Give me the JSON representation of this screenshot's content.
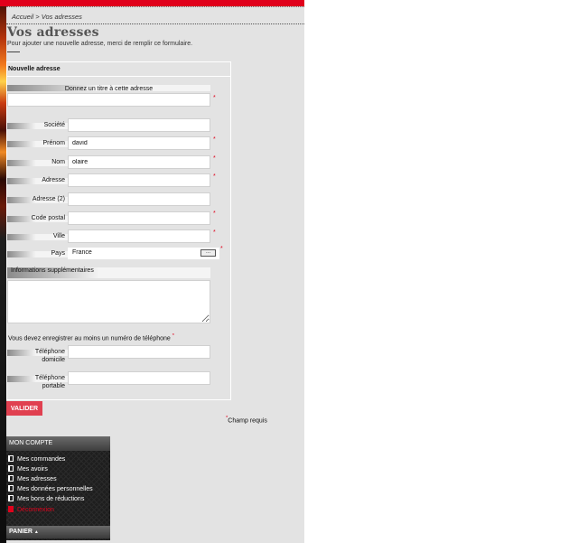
{
  "breadcrumb": {
    "home": "Accueil",
    "separator": " > ",
    "current": "Vos adresses"
  },
  "page": {
    "title": "Vos adresses",
    "intro": "Pour ajouter une nouvelle adresse, merci de remplir ce formulaire."
  },
  "form": {
    "legend": "Nouvelle adresse",
    "alias_label": "Donnez un titre à cette adresse",
    "required_mark": "*",
    "fields": {
      "company": {
        "label": "Société",
        "value": ""
      },
      "firstname": {
        "label": "Prénom",
        "value": "david"
      },
      "lastname": {
        "label": "Nom",
        "value": "olaire"
      },
      "address1": {
        "label": "Adresse",
        "value": ""
      },
      "address2": {
        "label": "Adresse (2)",
        "value": ""
      },
      "postcode": {
        "label": "Code postal",
        "value": ""
      },
      "city": {
        "label": "Ville",
        "value": ""
      },
      "country": {
        "label": "Pays",
        "value": "France",
        "button": "..."
      }
    },
    "extra_label": "Informations supplémentaires",
    "phone_note": "Vous devez enregistrer au moins un numéro de téléphone",
    "phone_home_label_1": "Téléphone",
    "phone_home_label_2": "domicile",
    "phone_mobile_label_1": "Téléphone",
    "phone_mobile_label_2": "portable",
    "submit": "VALIDER",
    "required_legend": "Champ requis"
  },
  "account": {
    "title": "MON COMPTE",
    "items": [
      "Mes commandes",
      "Mes avoirs",
      "Mes adresses",
      "Mes données personnelles",
      "Mes bons de réductions"
    ],
    "logout": "Déconnexion"
  },
  "cart": {
    "title": "PANIER",
    "arrow": "▲"
  },
  "colors": {
    "accent": "#e0001b",
    "button": "#e04050",
    "panel": "#1e1e1e",
    "page_bg": "#e3e3e3"
  }
}
